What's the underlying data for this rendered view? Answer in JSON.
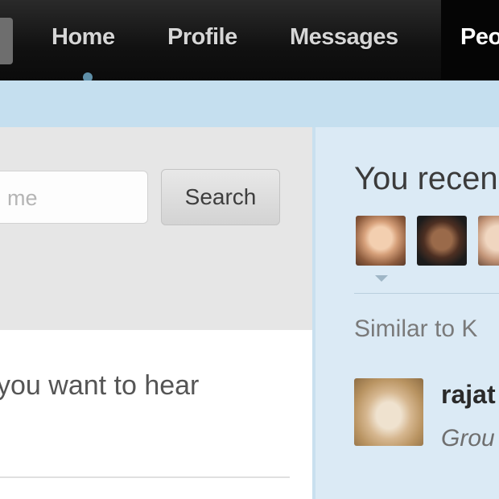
{
  "nav": {
    "items": [
      {
        "label": "Home"
      },
      {
        "label": "Profile"
      },
      {
        "label": "Messages"
      },
      {
        "label": "Peo"
      }
    ]
  },
  "search": {
    "placeholder_visible": "me",
    "button_label": "Search"
  },
  "main": {
    "prompt_text": "you want to hear"
  },
  "sidebar": {
    "heading": "You recen",
    "similar_label": "Similar to K",
    "suggestion": {
      "name": "rajat",
      "subtitle": "Grou"
    }
  },
  "colors": {
    "nav_bg": "#111111",
    "strip_bg": "#c5dfef",
    "sidebar_bg": "#dbeaf5",
    "left_panel_bg": "#e6e6e6"
  }
}
